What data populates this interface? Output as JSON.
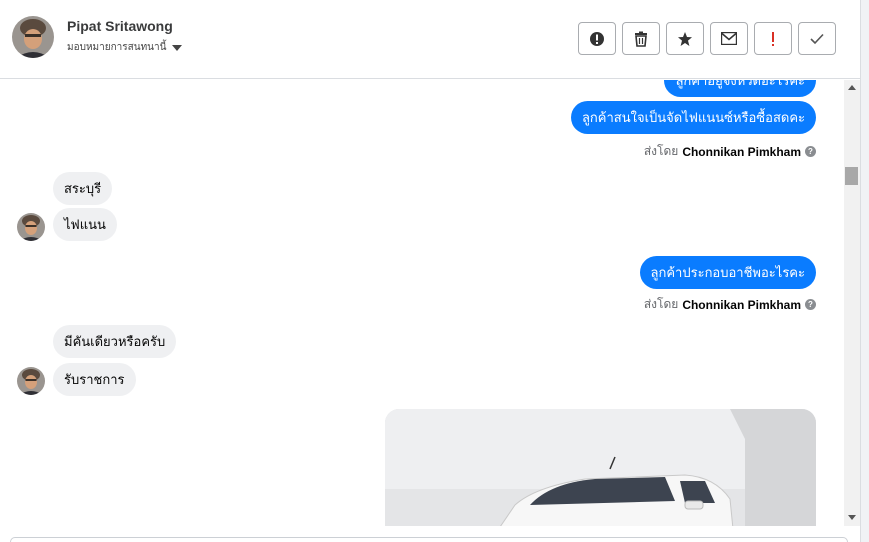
{
  "header": {
    "contact_name": "Pipat Sritawong",
    "assign_label": "มอบหมายการสนทนานี้",
    "actions": [
      {
        "name": "mark-spam-button",
        "icon": "alert-circle-icon"
      },
      {
        "name": "delete-button",
        "icon": "trash-icon"
      },
      {
        "name": "star-button",
        "icon": "star-icon"
      },
      {
        "name": "mark-unread-button",
        "icon": "envelope-icon"
      },
      {
        "name": "follow-up-button",
        "icon": "exclamation-icon"
      },
      {
        "name": "mark-done-button",
        "icon": "check-icon"
      }
    ]
  },
  "messages": {
    "out_1": "ลูกค้าอยู่จังหวัดอะไรคะ",
    "out_2": "ลูกค้าสนใจเป็นจัดไฟแนนซ์หรือซื้อสดคะ",
    "sent_by_prefix": "ส่งโดย",
    "sender": "Chonnikan Pimkham",
    "in_1": "สระบุรี",
    "in_2": "ไฟแนน",
    "out_3": "ลูกค้าประกอบอาชีพอะไรคะ",
    "in_3": "มีคันเดียวหรือครับ",
    "in_4": "รับราชการ"
  },
  "colors": {
    "outgoing_bubble": "#0a7cff",
    "incoming_bubble": "#eff0f2",
    "follow_up_red": "#d93025"
  }
}
